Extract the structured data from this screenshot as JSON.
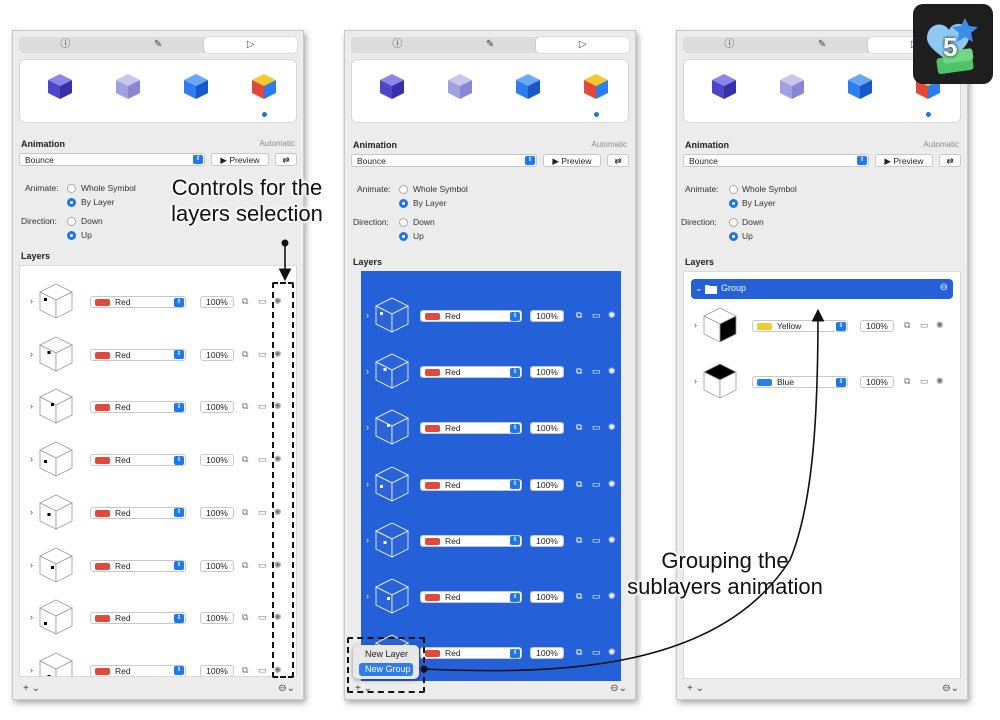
{
  "tabs": [
    {
      "icon": "info-icon",
      "glyph": "ⓘ"
    },
    {
      "icon": "brush-icon",
      "glyph": "✎"
    },
    {
      "icon": "play-icon",
      "glyph": "▷"
    }
  ],
  "animation": {
    "heading": "Animation",
    "automatic_label": "Automatic",
    "effect": "Bounce",
    "preview_label": "▶ Preview",
    "animate_label": "Animate:",
    "option_whole": "Whole Symbol",
    "option_by_layer": "By Layer",
    "direction_label": "Direction:",
    "option_down": "Down",
    "option_up": "Up",
    "selected_animate": "By Layer",
    "selected_direction": "Up"
  },
  "layers_heading": "Layers",
  "panel1": {
    "rows": [
      {
        "color": "Red",
        "opacity": "100%"
      },
      {
        "color": "Red",
        "opacity": "100%"
      },
      {
        "color": "Red",
        "opacity": "100%"
      },
      {
        "color": "Red",
        "opacity": "100%"
      },
      {
        "color": "Red",
        "opacity": "100%"
      },
      {
        "color": "Red",
        "opacity": "100%"
      },
      {
        "color": "Red",
        "opacity": "100%"
      },
      {
        "color": "Red",
        "opacity": "100%"
      }
    ]
  },
  "panel2": {
    "rows": [
      {
        "color": "Red",
        "opacity": "100%"
      },
      {
        "color": "Red",
        "opacity": "100%"
      },
      {
        "color": "Red",
        "opacity": "100%"
      },
      {
        "color": "Red",
        "opacity": "100%"
      },
      {
        "color": "Red",
        "opacity": "100%"
      },
      {
        "color": "Red",
        "opacity": "100%"
      },
      {
        "color": "Red",
        "opacity": "100%"
      }
    ],
    "menu": {
      "new_layer": "New Layer",
      "new_group": "New Group"
    }
  },
  "panel3": {
    "group_label": "Group",
    "rows": [
      {
        "color": "Yellow",
        "opacity": "100%"
      },
      {
        "color": "Blue",
        "opacity": "100%"
      }
    ]
  },
  "annotations": {
    "controls_line1": "Controls for the",
    "controls_line2": "layers selection",
    "grouping_line1": "Grouping  the",
    "grouping_line2": "sublayers animation"
  },
  "badge": {
    "number": "5"
  },
  "bottom": {
    "add": "+ ⌄",
    "options": "⊖⌄"
  },
  "colors": {
    "accent": "#1e74e8",
    "selection": "#2461d8",
    "red": "#e04a3c",
    "yellow": "#f4c92a",
    "blue": "#2e7df0"
  }
}
